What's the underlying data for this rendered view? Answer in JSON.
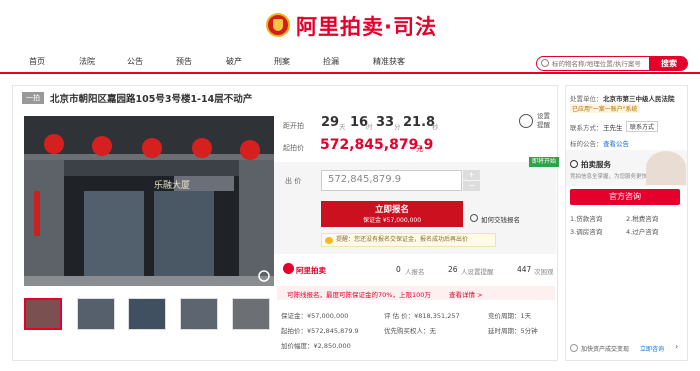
{
  "header": {
    "logo_text": "阿里拍卖·司法"
  },
  "nav": {
    "items": [
      "首页",
      "法院",
      "公告",
      "预告",
      "破产",
      "刑案",
      "捡漏",
      "精准获客"
    ]
  },
  "search": {
    "placeholder": "标的物名称/地理位置/执行案号",
    "button": "搜索"
  },
  "item": {
    "tag": "一拍",
    "title": "北京市朝阳区嘉园路105号3号楼1-14层不动产",
    "building_sign": "乐融大厦"
  },
  "countdown": {
    "label": "距开拍",
    "days": "29",
    "days_unit": "天",
    "hours": "16",
    "hours_unit": "时",
    "minutes": "33",
    "minutes_unit": "分",
    "seconds": "21.8",
    "seconds_unit": "秒",
    "reminder": "设置提醒"
  },
  "start_price": {
    "label": "起拍价",
    "value": "572,845,879.9",
    "unit": "元"
  },
  "bid": {
    "label": "出  价",
    "value": "572,845,879.9",
    "plus": "+",
    "minus": "−",
    "status_badge": "即将开始",
    "register_label": "立即报名",
    "deposit_label": "保证金 ¥57,000,000",
    "how_to": "如何交钱报名",
    "notice": "提醒：您还没有报名交保证金，报名成功后再出价"
  },
  "stats": {
    "brand": "阿里拍卖",
    "signup_count": "0",
    "signup_label": "人报名",
    "reminder_count": "26",
    "reminder_label": "人设置提醒",
    "watch_count": "447",
    "watch_label": "次围观"
  },
  "installment": {
    "text": "可陈线报名，最度可陈保证金的70%，上限100万",
    "link": "查看详情 >"
  },
  "details": {
    "deposit": "保证金：¥57,000,000",
    "appraisal": "评 估 价：¥818,351,257",
    "bid_period": "竞价周期：1天",
    "start_price": "起拍价：¥572,845,879.9",
    "priority": "优先购买权人：无",
    "delay_period": "延时周期：5分钟",
    "increment": "加价幅度：¥2,850,000"
  },
  "side": {
    "unit_label": "处置单位：",
    "unit_name": "北京市第三中级人民法院",
    "unit_badge": "已应用\"一案一账户\"系统",
    "contact_label": "联系方式：",
    "contact_name": "王先生",
    "contact_btn": "联系方式",
    "notice_label": "标的公告：",
    "notice_link": "查看公告",
    "service_title": "拍卖服务",
    "service_desc": "竞拍信息全掌握，为您服务更快捷",
    "consult_btn": "官方咨询",
    "links": [
      "1.贷款咨询",
      "2.税费咨询",
      "3.调房咨询",
      "4.过户咨询"
    ],
    "bottom_text": "加快资产成交变现",
    "bottom_link": "立即咨询"
  }
}
